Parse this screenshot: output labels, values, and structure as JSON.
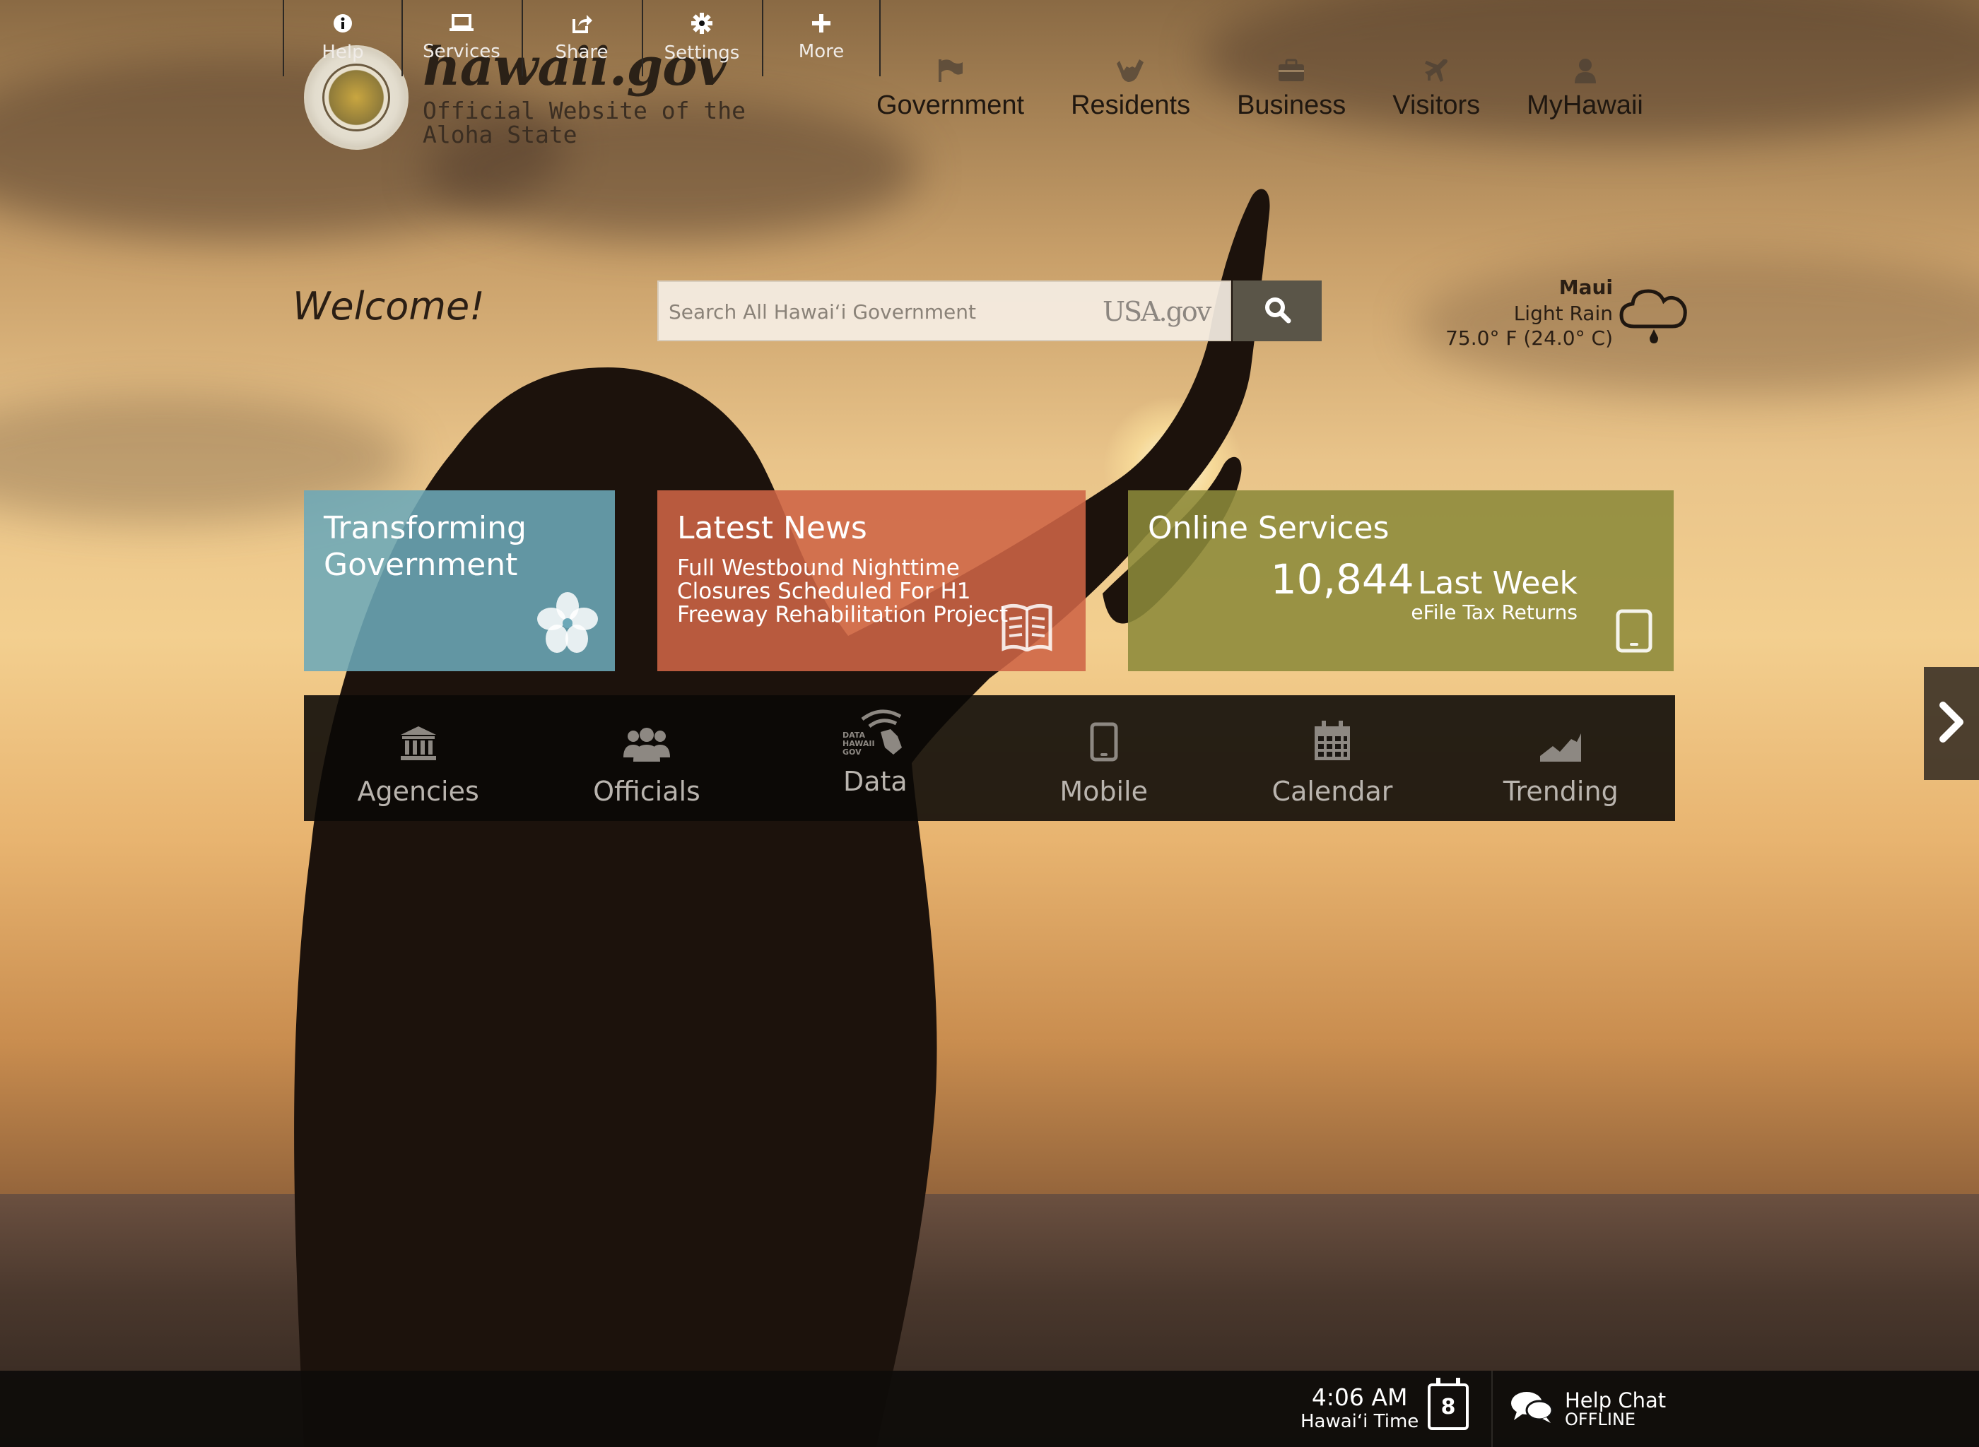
{
  "header": {
    "brand_title": "hawaii.gov",
    "brand_sub_line1": "Official Website of the",
    "brand_sub_line2": "Aloha State",
    "nav": [
      {
        "label": "Government",
        "icon": "flag-icon"
      },
      {
        "label": "Residents",
        "icon": "shaka-icon"
      },
      {
        "label": "Business",
        "icon": "briefcase-icon"
      },
      {
        "label": "Visitors",
        "icon": "airplane-icon"
      },
      {
        "label": "MyHawaii",
        "icon": "user-icon"
      }
    ]
  },
  "welcome": "Welcome!",
  "search": {
    "placeholder": "Search All Hawai‘i Government",
    "provider": "USA.gov"
  },
  "weather": {
    "location": "Maui",
    "condition": "Light Rain",
    "temperature": "75.0° F (24.0° C)",
    "icon": "rain-cloud-icon"
  },
  "tiles": {
    "transforming": {
      "title_line1": "Transforming",
      "title_line2": "Government",
      "icon": "hibiscus-icon",
      "color": "#6ca8b8"
    },
    "news": {
      "title": "Latest News",
      "text": "Full Westbound Nighttime Closures Scheduled For H1 Freeway Rehabilitation Project",
      "icon": "newspaper-icon",
      "color": "#ce6446"
    },
    "services": {
      "title": "Online Services",
      "count": "10,844",
      "period": "Last Week",
      "subtitle": "eFile Tax Returns",
      "icon": "tablet-icon",
      "color": "#8c8a3a"
    }
  },
  "quicklinks": [
    {
      "label": "Agencies",
      "icon": "building-icon"
    },
    {
      "label": "Officials",
      "icon": "people-icon"
    },
    {
      "label": "Data",
      "icon": "data-hawaii-icon",
      "icon_text": [
        "DATA",
        "HAWAII",
        "GOV"
      ]
    },
    {
      "label": "Mobile",
      "icon": "mobile-icon"
    },
    {
      "label": "Calendar",
      "icon": "calendar-icon"
    },
    {
      "label": "Trending",
      "icon": "trending-icon"
    }
  ],
  "toolbar": {
    "items": [
      {
        "label": "Help",
        "icon": "info-icon"
      },
      {
        "label": "Services",
        "icon": "laptop-icon"
      },
      {
        "label": "Share",
        "icon": "share-icon"
      },
      {
        "label": "Settings",
        "icon": "gear-icon"
      },
      {
        "label": "More",
        "icon": "plus-icon"
      }
    ],
    "time": "4:06 AM",
    "time_zone": "Hawai‘i Time",
    "calendar_day": "8",
    "chat_label": "Help Chat",
    "chat_status": "OFFLINE"
  }
}
